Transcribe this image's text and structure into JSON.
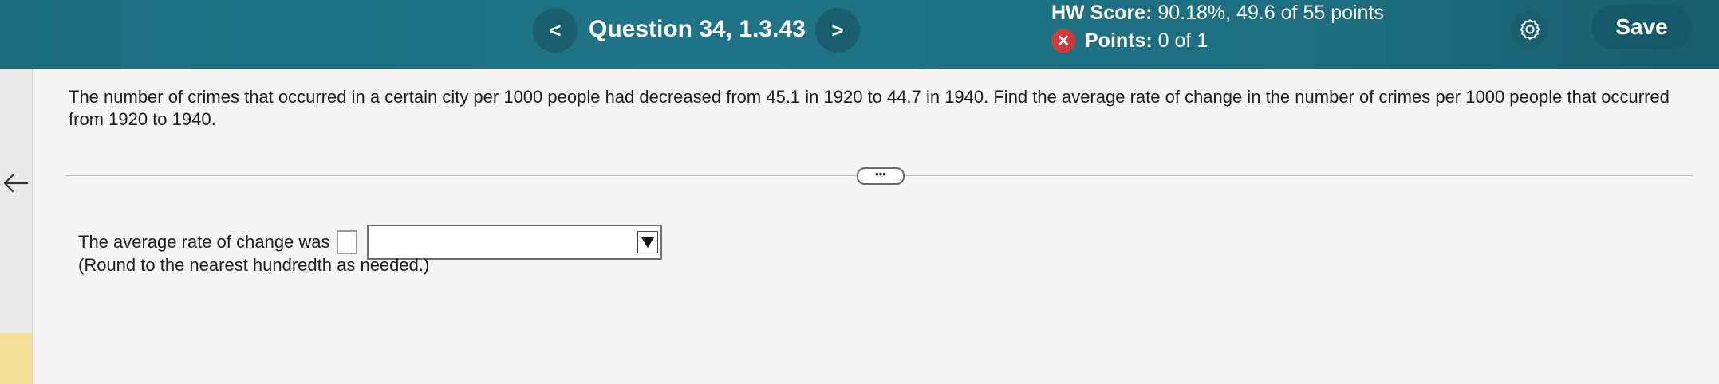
{
  "header": {
    "prev_icon": "chevron-left-icon",
    "prev_glyph": "<",
    "question_title": "Question 34, 1.3.43",
    "next_icon": "chevron-right-icon",
    "next_glyph": ">",
    "hw_score_label": "HW Score:",
    "hw_score_value": "90.18%, 49.6 of 55 points",
    "points_icon": "x-circle-icon",
    "points_glyph": "✕",
    "points_label": "Points:",
    "points_value": "0 of 1",
    "settings_icon": "gear-icon",
    "save_label": "Save"
  },
  "sidebar": {
    "back_icon": "back-arrow-icon"
  },
  "question": {
    "text": "The number of crimes that occurred in a certain city per 1000 people had decreased from 45.1 in 1920 to 44.7 in 1940. Find the average rate of change in the number of crimes per 1000 people that occurred from 1920 to 1940.",
    "more_label": "•••"
  },
  "answer": {
    "prompt": "The average rate of change was",
    "value": "",
    "unit_selected": "",
    "dropdown_icon": "triangle-down-icon",
    "note": "(Round to the nearest hundredth as needed.)"
  },
  "colors": {
    "header_bg": "#1f7586",
    "button_bg": "#165a6a",
    "error_red": "#d13a3a"
  }
}
